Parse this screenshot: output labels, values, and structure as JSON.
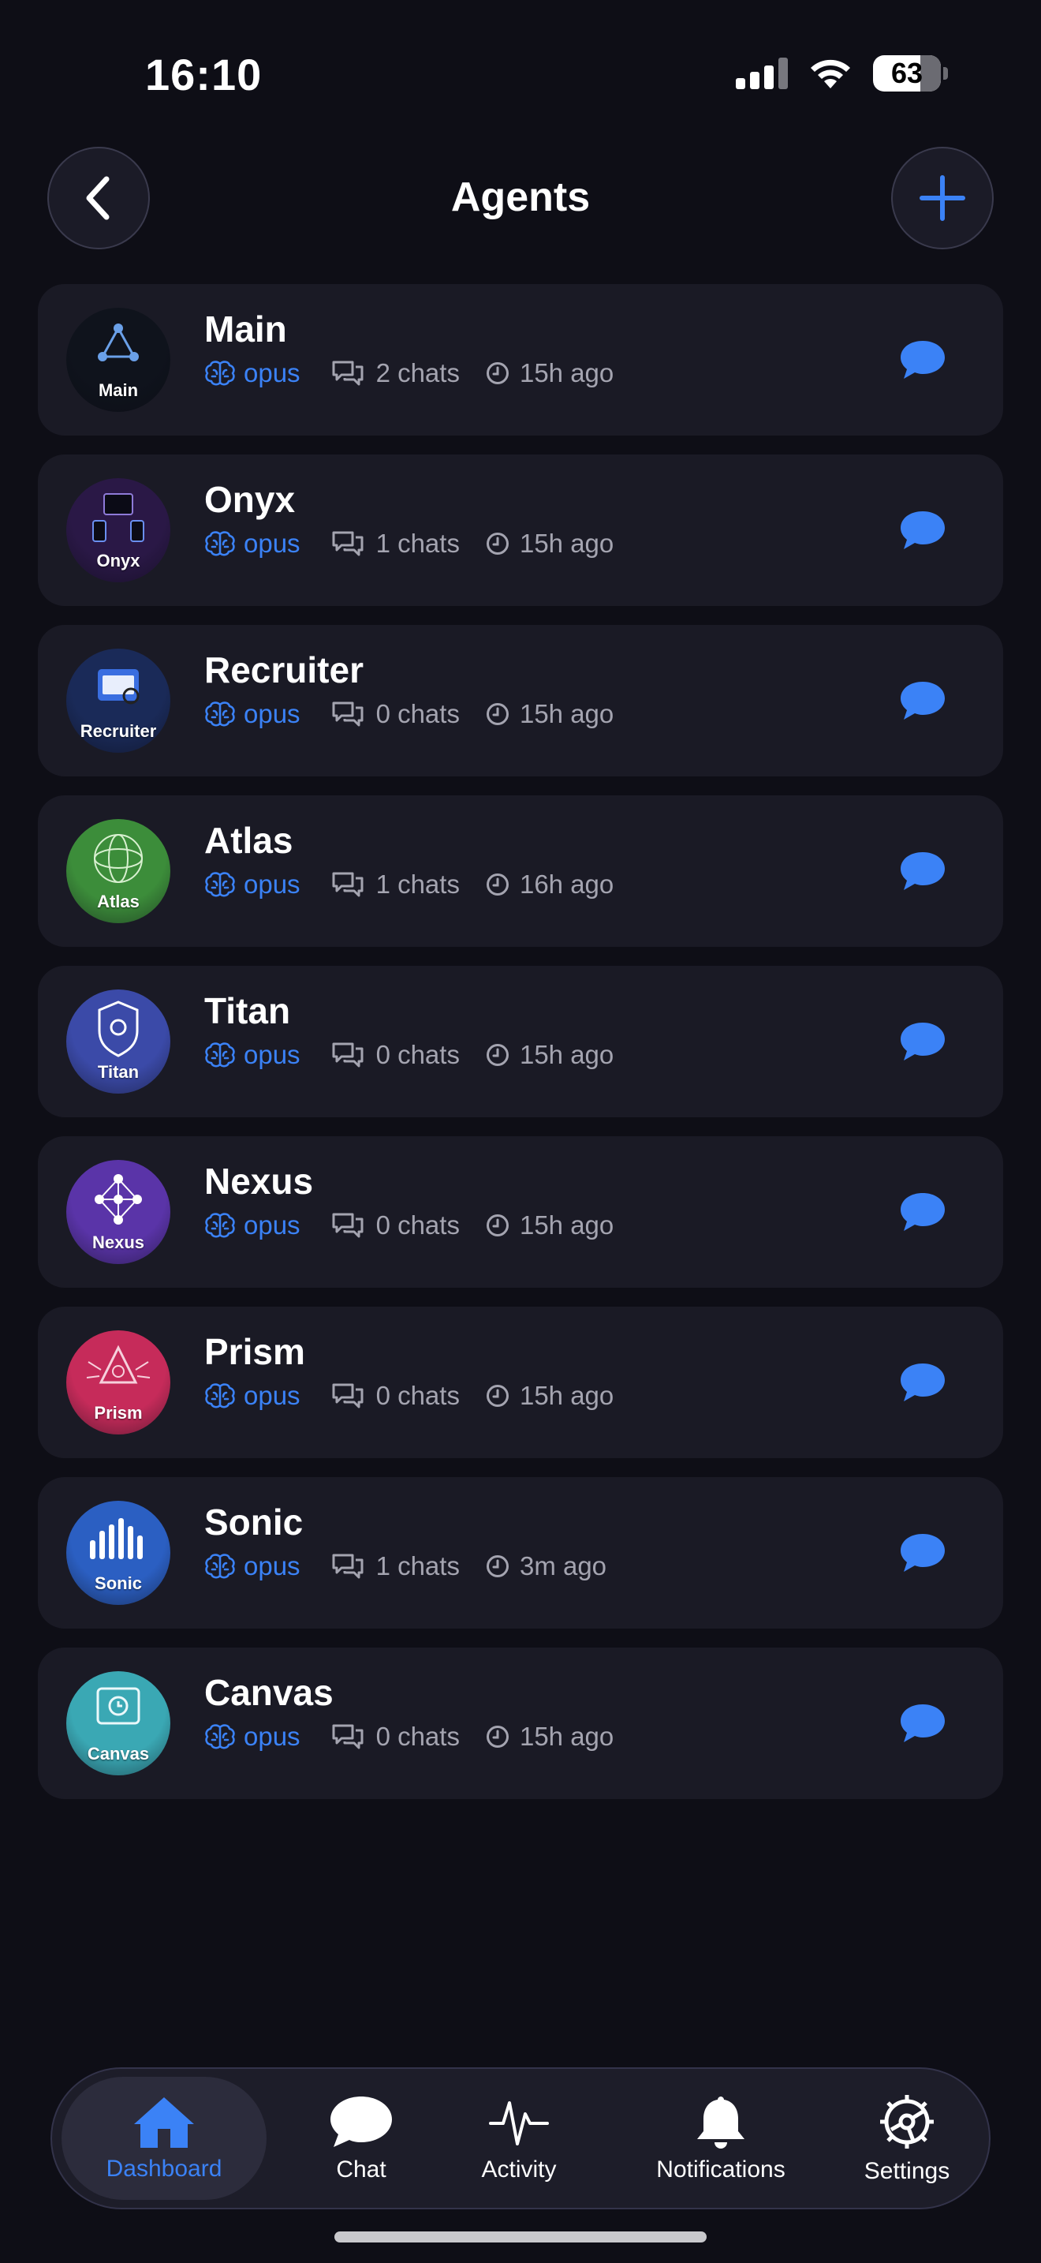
{
  "status_bar": {
    "time": "16:10",
    "battery": "63"
  },
  "header": {
    "title": "Agents"
  },
  "agents": [
    {
      "name": "Main",
      "avatar_label": "Main",
      "model": "opus",
      "chats": "2 chats",
      "last_active": "15h ago",
      "avatar_color": "#0f131c"
    },
    {
      "name": "Onyx",
      "avatar_label": "Onyx",
      "model": "opus",
      "chats": "1 chats",
      "last_active": "15h ago",
      "avatar_color": "#2a1846"
    },
    {
      "name": "Recruiter",
      "avatar_label": "Recruiter",
      "model": "opus",
      "chats": "0 chats",
      "last_active": "15h ago",
      "avatar_color": "#1a2a58"
    },
    {
      "name": "Atlas",
      "avatar_label": "Atlas",
      "model": "opus",
      "chats": "1 chats",
      "last_active": "16h ago",
      "avatar_color": "#3c8d3a"
    },
    {
      "name": "Titan",
      "avatar_label": "Titan",
      "model": "opus",
      "chats": "0 chats",
      "last_active": "15h ago",
      "avatar_color": "#3b4aa8"
    },
    {
      "name": "Nexus",
      "avatar_label": "Nexus",
      "model": "opus",
      "chats": "0 chats",
      "last_active": "15h ago",
      "avatar_color": "#5a34a8"
    },
    {
      "name": "Prism",
      "avatar_label": "Prism",
      "model": "opus",
      "chats": "0 chats",
      "last_active": "15h ago",
      "avatar_color": "#c62b5a"
    },
    {
      "name": "Sonic",
      "avatar_label": "Sonic",
      "model": "opus",
      "chats": "1 chats",
      "last_active": "3m ago",
      "avatar_color": "#2b5fc2"
    },
    {
      "name": "Canvas",
      "avatar_label": "Canvas",
      "model": "opus",
      "chats": "0 chats",
      "last_active": "15h ago",
      "avatar_color": "#3aa8b4"
    }
  ],
  "tabs": [
    {
      "label": "Dashboard",
      "icon": "home-icon",
      "active": true
    },
    {
      "label": "Chat",
      "icon": "chat-bubble-icon",
      "active": false
    },
    {
      "label": "Activity",
      "icon": "pulse-icon",
      "active": false
    },
    {
      "label": "Notifications",
      "icon": "bell-icon",
      "active": false
    },
    {
      "label": "Settings",
      "icon": "gear-icon",
      "active": false
    }
  ],
  "colors": {
    "accent": "#3b82f6",
    "background": "#0e0e16",
    "card": "#1a1a25"
  }
}
